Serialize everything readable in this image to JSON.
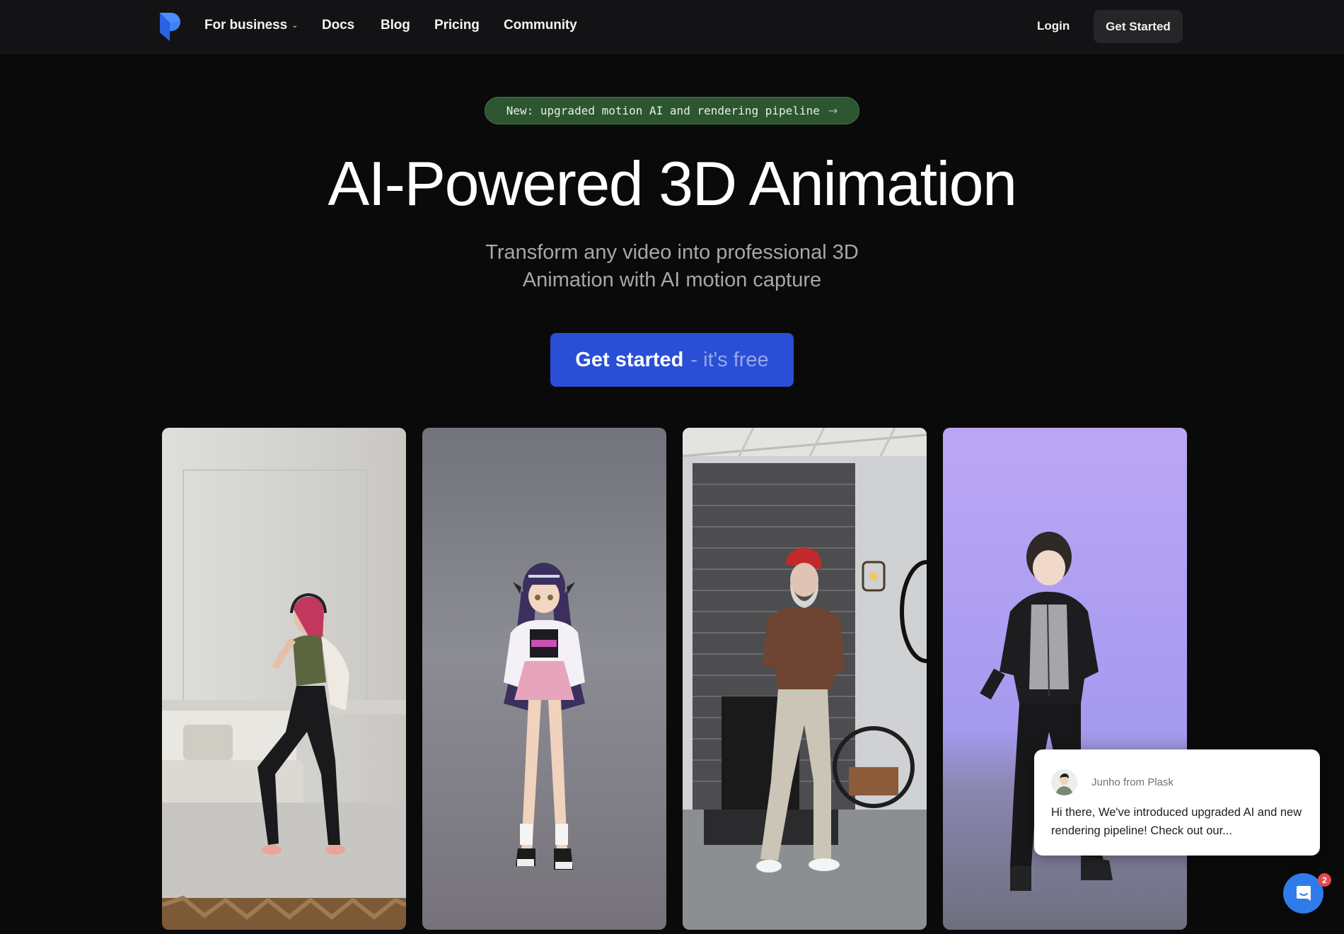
{
  "nav": {
    "brand": "Plask",
    "items": [
      {
        "label": "For business",
        "has_dropdown": true
      },
      {
        "label": "Docs"
      },
      {
        "label": "Blog"
      },
      {
        "label": "Pricing"
      },
      {
        "label": "Community"
      }
    ],
    "login_label": "Login",
    "get_started_label": "Get Started"
  },
  "hero": {
    "announcement": "New: upgraded motion AI and rendering pipeline",
    "announcement_icon": "arrow-right-icon",
    "title": "AI-Powered 3D Animation",
    "subtitle_line1": "Transform any video into professional 3D",
    "subtitle_line2": "Animation with AI motion capture",
    "cta_main": "Get started",
    "cta_sub": "- it's free"
  },
  "showcase": {
    "cards": [
      {
        "description": "Woman with pink hair and headphones dancing in a white living room"
      },
      {
        "description": "3D anime girl avatar with purple hair mirroring the dance motion"
      },
      {
        "description": "Older man with red beanie dancing in front of a brick fireplace"
      },
      {
        "description": "3D anime boy avatar in black jacket mirroring the motion on a purple background"
      }
    ]
  },
  "chat": {
    "sender": "Junho from Plask",
    "message": "Hi there, We've introduced upgraded AI and new rendering pipeline! Check out our...",
    "unread_count": "2"
  },
  "colors": {
    "background": "#0a0a0b",
    "nav_background": "#131315",
    "badge_green": "#2c5530",
    "cta_blue": "#2a4fd6",
    "launcher_blue": "#2f7bea",
    "unread_red": "#e5484d",
    "logo_blue": "#3b7cf6"
  }
}
